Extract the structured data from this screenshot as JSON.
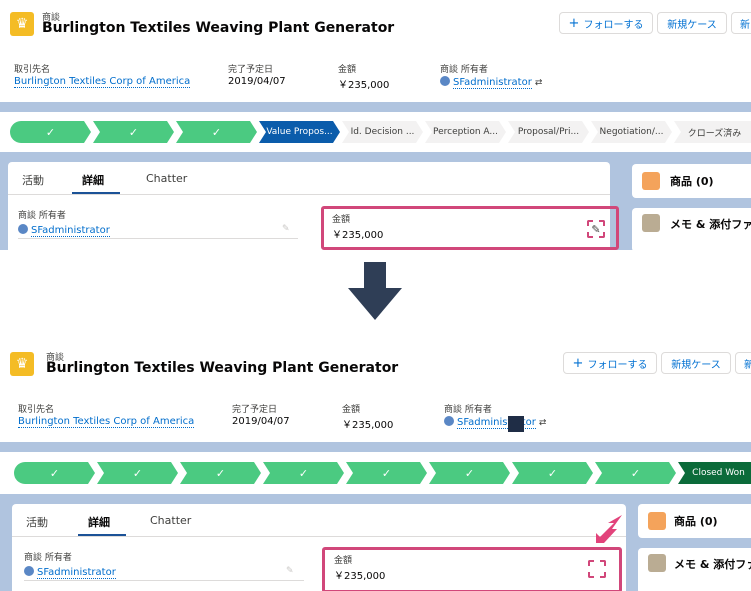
{
  "before": {
    "header": {
      "object_label": "商談",
      "title": "Burlington Textiles Weaving Plant Generator",
      "follow_button": "フォローする",
      "new_case_button": "新規ケース",
      "next_button_partial": "新"
    },
    "fields": {
      "account_label": "取引先名",
      "account_value": "Burlington Textiles Corp of America",
      "close_date_label": "完了予定日",
      "close_date_value": "2019/04/07",
      "amount_label": "金額",
      "amount_value": "￥235,000",
      "owner_label": "商談 所有者",
      "owner_value": "SFadministrator"
    },
    "path": {
      "completed_steps": 3,
      "steps": [
        {
          "label": "✓",
          "state": "done"
        },
        {
          "label": "✓",
          "state": "done"
        },
        {
          "label": "✓",
          "state": "done"
        },
        {
          "label": "Value Propos...",
          "state": "current"
        },
        {
          "label": "Id. Decision ...",
          "state": "incomplete"
        },
        {
          "label": "Perception A...",
          "state": "incomplete"
        },
        {
          "label": "Proposal/Pri...",
          "state": "incomplete"
        },
        {
          "label": "Negotiation/...",
          "state": "incomplete"
        },
        {
          "label": "クローズ済み",
          "state": "incomplete"
        }
      ]
    },
    "tabs": {
      "activity": "活動",
      "details": "詳細",
      "chatter": "Chatter"
    },
    "details": {
      "owner_label": "商談 所有者",
      "owner_value": "SFadministrator",
      "amount_label": "金額",
      "amount_value": "￥235,000"
    },
    "sidebar": {
      "products_title": "商品 (0)",
      "notes_title": "メモ & 添付ファ"
    }
  },
  "after": {
    "header": {
      "object_label": "商談",
      "title": "Burlington Textiles Weaving Plant Generator",
      "follow_button": "フォローする",
      "new_case_button": "新規ケース",
      "next_button_partial": "新"
    },
    "fields": {
      "account_label": "取引先名",
      "account_value": "Burlington Textiles Corp of America",
      "close_date_label": "完了予定日",
      "close_date_value": "2019/04/07",
      "amount_label": "金額",
      "amount_value": "￥235,000",
      "owner_label": "商談 所有者",
      "owner_value": "SFadministrator"
    },
    "path": {
      "completed_steps": 8,
      "steps": [
        {
          "label": "✓",
          "state": "done"
        },
        {
          "label": "✓",
          "state": "done"
        },
        {
          "label": "✓",
          "state": "done"
        },
        {
          "label": "✓",
          "state": "done"
        },
        {
          "label": "✓",
          "state": "done"
        },
        {
          "label": "✓",
          "state": "done"
        },
        {
          "label": "✓",
          "state": "done"
        },
        {
          "label": "✓",
          "state": "done"
        },
        {
          "label": "Closed Won",
          "state": "won"
        }
      ]
    },
    "tabs": {
      "activity": "活動",
      "details": "詳細",
      "chatter": "Chatter"
    },
    "details": {
      "owner_label": "商談 所有者",
      "owner_value": "SFadministrator",
      "amount_label": "金額",
      "amount_value": "￥235,000"
    },
    "sidebar": {
      "products_title": "商品 (0)",
      "notes_title": "メモ & 添付ファ"
    }
  },
  "colors": {
    "highlight": "#d1477a",
    "path_done": "#4bca81",
    "path_current": "#0b5cab",
    "path_won": "#0b6b3a",
    "link": "#006dcc",
    "arrow": "#2f3e56"
  },
  "icons": {
    "crown": "crown-icon",
    "pencil": "pencil-icon",
    "products": "product-icon",
    "notes": "notes-icon"
  }
}
